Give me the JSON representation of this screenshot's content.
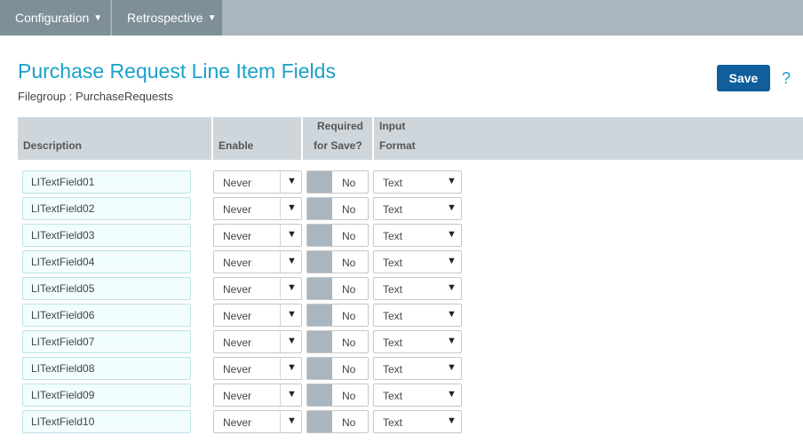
{
  "nav": {
    "configuration": "Configuration",
    "retrospective": "Retrospective",
    "caret": "▼"
  },
  "header": {
    "title": "Purchase Request Line Item Fields",
    "filegroup": "Filegroup : PurchaseRequests",
    "save_label": "Save",
    "help": "?"
  },
  "table": {
    "headers": {
      "description": "Description",
      "enable": "Enable",
      "required_line1": "Required",
      "required_line2": "for Save?",
      "format_line1": "Input",
      "format_line2": "Format"
    },
    "rows": [
      {
        "description": "LITextField01",
        "enable": "Never",
        "required": "No",
        "format": "Text"
      },
      {
        "description": "LITextField02",
        "enable": "Never",
        "required": "No",
        "format": "Text"
      },
      {
        "description": "LITextField03",
        "enable": "Never",
        "required": "No",
        "format": "Text"
      },
      {
        "description": "LITextField04",
        "enable": "Never",
        "required": "No",
        "format": "Text"
      },
      {
        "description": "LITextField05",
        "enable": "Never",
        "required": "No",
        "format": "Text"
      },
      {
        "description": "LITextField06",
        "enable": "Never",
        "required": "No",
        "format": "Text"
      },
      {
        "description": "LITextField07",
        "enable": "Never",
        "required": "No",
        "format": "Text"
      },
      {
        "description": "LITextField08",
        "enable": "Never",
        "required": "No",
        "format": "Text"
      },
      {
        "description": "LITextField09",
        "enable": "Never",
        "required": "No",
        "format": "Text"
      },
      {
        "description": "LITextField10",
        "enable": "Never",
        "required": "No",
        "format": "Text"
      }
    ]
  },
  "colors": {
    "topbar": "#a9b6bf",
    "nav_button": "#7f8f99",
    "title": "#1aa0c8",
    "save_button": "#105e9c",
    "header_bg": "#cfd6db",
    "input_bg": "#f2fdfd"
  },
  "icons": {
    "dropdown": "caret-down-icon",
    "help": "question-mark-icon"
  }
}
